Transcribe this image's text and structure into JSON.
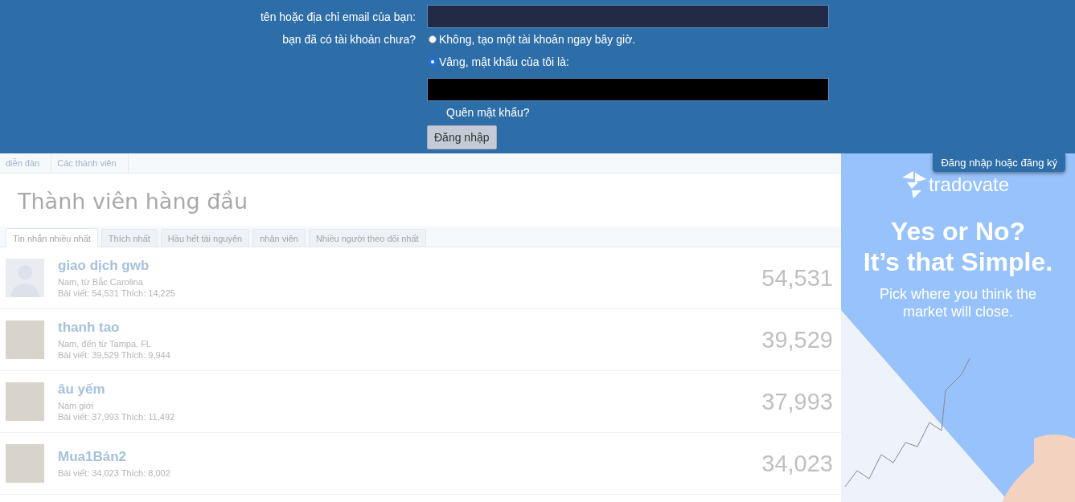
{
  "login_form": {
    "username_label": "tên hoặc địa chỉ email của bạn:",
    "account_label": "bạn đã có tài khoản chưa?",
    "options": [
      {
        "label": "Không, tạo một tài khoản ngay bây giờ.",
        "selected": false
      },
      {
        "label": "Vâng, mật khẩu của tôi là:",
        "selected": true
      }
    ],
    "forgot_link": "Quên mật khẩu?",
    "submit": "Đăng nhập"
  },
  "login_tab": "Đăng nhập hoặc đăng ký",
  "breadcrumbs": [
    "diễn đàn",
    "Các thành viên"
  ],
  "title": "Thành viên hàng đầu",
  "tabs": [
    {
      "label": "Tin nhắn nhiều nhất",
      "selected": true
    },
    {
      "label": "Thích nhất",
      "selected": false
    },
    {
      "label": "Hầu hết tài nguyên",
      "selected": false
    },
    {
      "label": "nhân viên",
      "selected": false
    },
    {
      "label": "Nhiều người theo dõi nhất",
      "selected": false
    }
  ],
  "members": [
    {
      "kind": "silhouette",
      "name": "giao dịch gwb",
      "location": "Nam, từ Bắc Carolina",
      "stats": "Bài viết: 54,531 Thích: 14,225",
      "count": "54,531"
    },
    {
      "kind": "photo",
      "name": "thanh tao",
      "location": "Nam, đến từ Tampa, FL",
      "stats": "Bài viết: 39,529 Thích: 9,944",
      "count": "39,529"
    },
    {
      "kind": "photo",
      "name": "âu yếm",
      "location": "Nam giới",
      "stats": "Bài viết: 37,993 Thích: 11,492",
      "count": "37,993"
    },
    {
      "kind": "photo",
      "name": "Mua1Bán2",
      "stats": "Bài viết: 34,023 Thích: 8,002",
      "count": "34,023"
    }
  ],
  "ad": {
    "logo": "tradovate",
    "headline": [
      "Yes or No?",
      "It’s that Simple."
    ],
    "subline": "Pick where you think the market will close."
  }
}
